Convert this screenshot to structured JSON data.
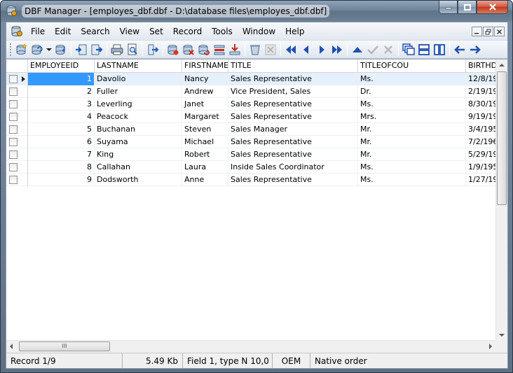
{
  "window": {
    "title": "DBF Manager - [employes_dbf.dbf - D:\\database files\\employes_dbf.dbf]"
  },
  "menu": {
    "items": [
      "File",
      "Edit",
      "Search",
      "View",
      "Set",
      "Record",
      "Tools",
      "Window",
      "Help"
    ]
  },
  "toolbar": {
    "buttons": [
      "new-table-icon",
      "open-table-icon",
      "dropdown-arrow-icon",
      "save-icon",
      "import-icon",
      "export-icon",
      "print-icon",
      "print-preview-icon",
      "exit-icon",
      "add-record-icon",
      "delete-record-icon",
      "undelete-record-icon",
      "insert-record-icon",
      "append-record-icon",
      "pack-icon",
      "zap-icon",
      "first-record-icon",
      "prior-record-icon",
      "next-record-icon",
      "last-record-icon",
      "post-icon",
      "confirm-icon",
      "cancel-icon",
      "cascade-icon",
      "tile-horizontal-icon",
      "tile-vertical-icon",
      "back-icon",
      "forward-icon"
    ]
  },
  "grid": {
    "columns": [
      "EMPLOYEEID",
      "LASTNAME",
      "FIRSTNAME",
      "TITLE",
      "TITLEOFCOU",
      "BIRTHD"
    ],
    "rows": [
      {
        "id": "1",
        "last": "Davolio",
        "first": "Nancy",
        "title": "Sales Representative",
        "toc": "Ms.",
        "birth": "12/8/19"
      },
      {
        "id": "2",
        "last": "Fuller",
        "first": "Andrew",
        "title": "Vice President, Sales",
        "toc": "Dr.",
        "birth": "2/19/19"
      },
      {
        "id": "3",
        "last": "Leverling",
        "first": "Janet",
        "title": "Sales Representative",
        "toc": "Ms.",
        "birth": "8/30/19"
      },
      {
        "id": "4",
        "last": "Peacock",
        "first": "Margaret",
        "title": "Sales Representative",
        "toc": "Mrs.",
        "birth": "9/19/19"
      },
      {
        "id": "5",
        "last": "Buchanan",
        "first": "Steven",
        "title": "Sales Manager",
        "toc": "Mr.",
        "birth": "3/4/195"
      },
      {
        "id": "6",
        "last": "Suyama",
        "first": "Michael",
        "title": "Sales Representative",
        "toc": "Mr.",
        "birth": "7/2/196"
      },
      {
        "id": "7",
        "last": "King",
        "first": "Robert",
        "title": "Sales Representative",
        "toc": "Mr.",
        "birth": "5/29/19"
      },
      {
        "id": "8",
        "last": "Callahan",
        "first": "Laura",
        "title": "Inside Sales Coordinator",
        "toc": "Ms.",
        "birth": "1/9/195"
      },
      {
        "id": "9",
        "last": "Dodsworth",
        "first": "Anne",
        "title": "Sales Representative",
        "toc": "Ms.",
        "birth": "1/27/19"
      }
    ],
    "hscroll_thumb_label": "III"
  },
  "status": {
    "record": "Record 1/9",
    "size": "5.49 Kb",
    "field": "Field 1, type N 10,0",
    "codepage": "OEM",
    "order": "Native order"
  }
}
